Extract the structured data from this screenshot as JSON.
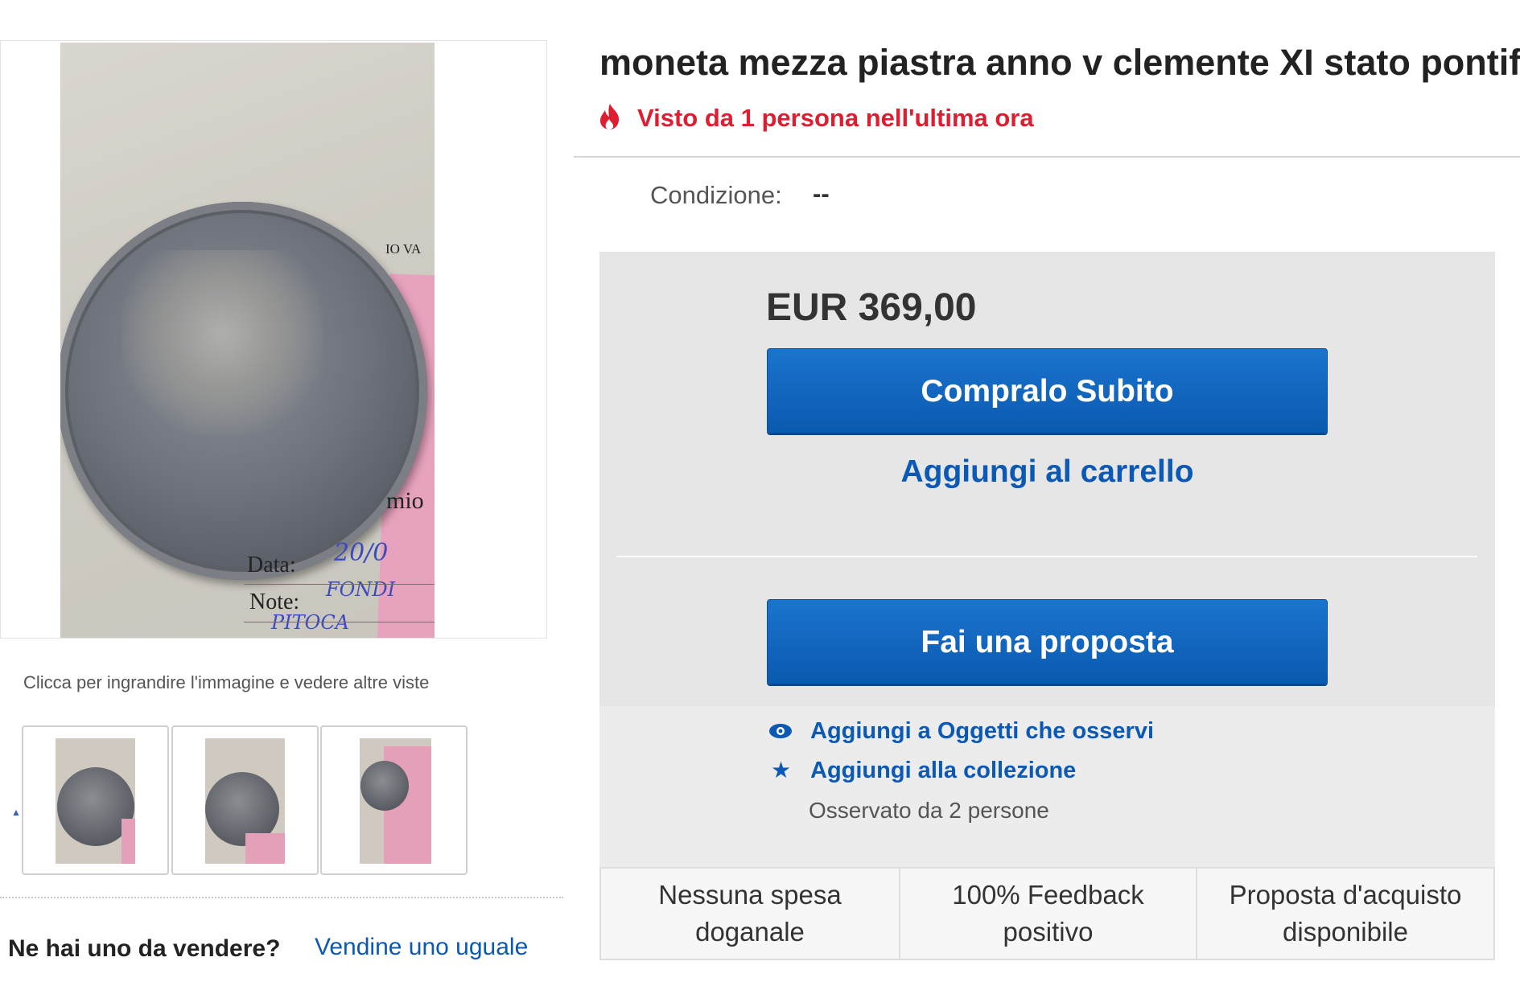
{
  "listing": {
    "title": "moneta mezza piastra anno v clemente XI stato pontif",
    "viewed_notice": "Visto da 1 persona nell'ultima ora",
    "condition_label": "Condizione:",
    "condition_value": "--"
  },
  "gallery": {
    "caption": "Clicca per ingrandire l'immagine e vedere altre viste",
    "card_text": {
      "fragment_top": "IO VA",
      "fragment_mid": "mio",
      "data_label": "Data:",
      "data_value": "20/0",
      "note_label": "Note:",
      "note_value": "FONDI",
      "note_value2": "PITOCA"
    },
    "thumbnails": [
      {
        "label": "thumbnail-1"
      },
      {
        "label": "thumbnail-2"
      },
      {
        "label": "thumbnail-3"
      }
    ]
  },
  "sell": {
    "question": "Ne hai uno da vendere?",
    "link": "Vendine uno uguale"
  },
  "buy_box": {
    "price": "EUR 369,00",
    "buy_now": "Compralo Subito",
    "add_to_cart": "Aggiungi al carrello",
    "make_offer": "Fai una proposta",
    "watch": "Aggiungi a Oggetti che osservi",
    "collection": "Aggiungi alla collezione",
    "watchers": "Osservato da 2 persone"
  },
  "badges": [
    {
      "line1": "Nessuna spesa",
      "line2": "doganale"
    },
    {
      "line1": "100% Feedback",
      "line2": "positivo"
    },
    {
      "line1": "Proposta d'acquisto",
      "line2": "disponibile"
    }
  ],
  "colors": {
    "link_blue": "#0b59b5",
    "alert_red": "#dd1e31",
    "button_blue": "#0a59b0"
  },
  "icons": [
    "flame-icon",
    "eye-icon",
    "star-icon"
  ]
}
